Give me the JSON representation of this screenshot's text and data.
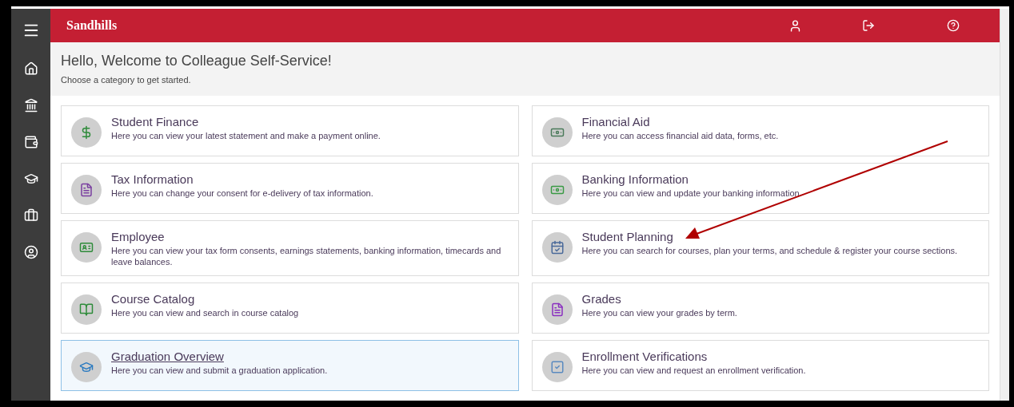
{
  "header": {
    "logo": "Sandhills"
  },
  "welcome": {
    "title": "Hello, Welcome to Colleague Self-Service!",
    "subtitle": "Choose a category to get started."
  },
  "sidebar": {
    "items": [
      {
        "kind": "home"
      },
      {
        "kind": "bank"
      },
      {
        "kind": "finance"
      },
      {
        "kind": "cap"
      },
      {
        "kind": "briefcase"
      },
      {
        "kind": "user"
      }
    ]
  },
  "cards": [
    {
      "kind": "finance",
      "title": "Student Finance",
      "description": "Here you can view your latest statement and make a payment online.",
      "selected": false
    },
    {
      "kind": "aid",
      "title": "Financial Aid",
      "description": "Here you can access financial aid data, forms, etc.",
      "selected": false
    },
    {
      "kind": "tax",
      "title": "Tax Information",
      "description": "Here you can change your consent for e-delivery of tax information.",
      "selected": false
    },
    {
      "kind": "banking",
      "title": "Banking Information",
      "description": "Here you can view and update your banking information.",
      "selected": false
    },
    {
      "kind": "employee",
      "title": "Employee",
      "description": "Here you can view your tax form consents, earnings statements, banking information, timecards and leave balances.",
      "selected": false
    },
    {
      "kind": "planning",
      "title": "Student Planning",
      "description": "Here you can search for courses, plan your terms, and schedule & register your course sections.",
      "selected": false
    },
    {
      "kind": "catalog",
      "title": "Course Catalog",
      "description": "Here you can view and search in course catalog",
      "selected": false
    },
    {
      "kind": "grades",
      "title": "Grades",
      "description": "Here you can view your grades by term.",
      "selected": false
    },
    {
      "kind": "graduation",
      "title": "Graduation Overview",
      "description": "Here you can view and submit a graduation application.",
      "selected": true
    },
    {
      "kind": "enrollment",
      "title": "Enrollment Verifications",
      "description": "Here you can view and request an enrollment verification.",
      "selected": false
    }
  ]
}
